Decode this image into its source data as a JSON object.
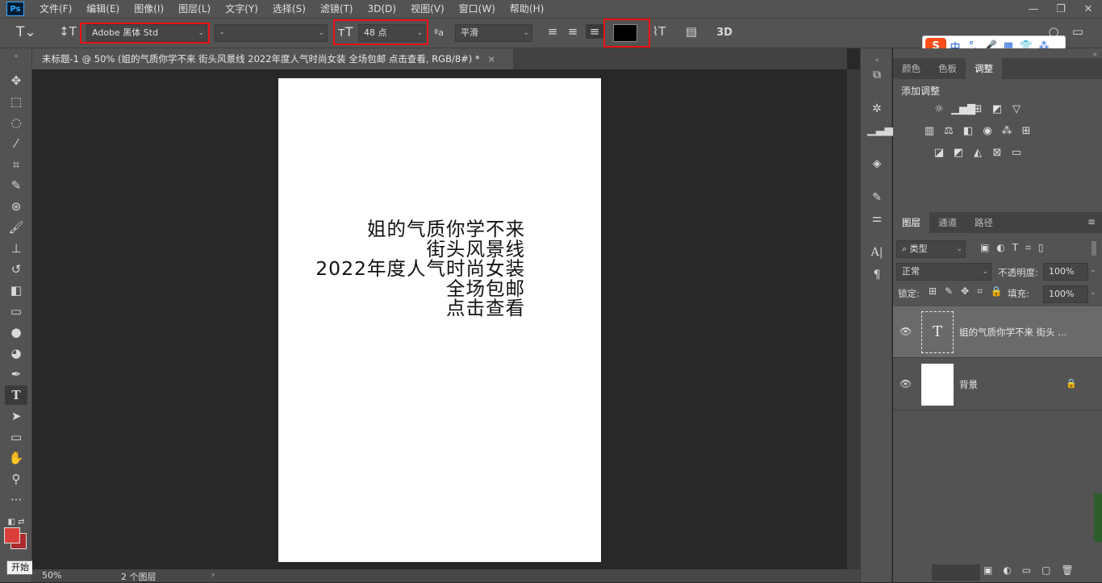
{
  "app_logo": "Ps",
  "menu": [
    "文件(F)",
    "编辑(E)",
    "图像(I)",
    "图层(L)",
    "文字(Y)",
    "选择(S)",
    "滤镜(T)",
    "3D(D)",
    "视图(V)",
    "窗口(W)",
    "帮助(H)"
  ],
  "options_bar": {
    "font_family": "Adobe 黑体 Std",
    "font_style": "-",
    "font_size": "48 点",
    "antialias": "平滑",
    "text_color": "#000000",
    "three_d_label": "3D"
  },
  "document": {
    "tab_title": "未标题-1 @ 50% (姐的气质你学不来 街头风景线 2022年度人气时尚女装 全场包邮 点击查看, RGB/8#) *",
    "text_lines": [
      "姐的气质你学不来",
      "街头风景线",
      "2022年度人气时尚女装",
      "全场包邮",
      "点击查看"
    ]
  },
  "status": {
    "zoom": "50%",
    "info": "2 个图层"
  },
  "panels": {
    "top_tabs": [
      "颜色",
      "色板",
      "调整"
    ],
    "active_top_tab": "调整",
    "adjust_heading": "添加调整",
    "layer_tabs": [
      "图层",
      "通道",
      "路径"
    ],
    "filter_kind": "类型",
    "blend_mode": "正常",
    "opacity_label": "不透明度:",
    "opacity_value": "100%",
    "lock_label": "锁定:",
    "fill_label": "填充:",
    "fill_value": "100%",
    "layers": [
      {
        "name": "姐的气质你学不来 街头 ...",
        "type": "text"
      },
      {
        "name": "背景",
        "type": "background"
      }
    ]
  },
  "ime": {
    "mode": "中"
  },
  "tooltip": "开始"
}
